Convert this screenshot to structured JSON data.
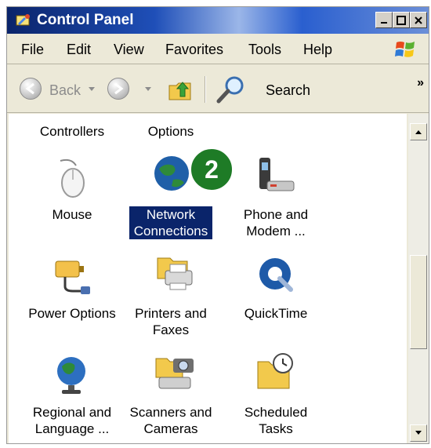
{
  "window": {
    "title": "Control Panel"
  },
  "menu": [
    "File",
    "Edit",
    "View",
    "Favorites",
    "Tools",
    "Help"
  ],
  "toolbar": {
    "back_label": "Back",
    "search_label": "Search",
    "chevron": "»"
  },
  "items": {
    "controllers": "Controllers",
    "options": "Options",
    "mouse": "Mouse",
    "network_1": "Network",
    "network_2": "Connections",
    "phone_1": "Phone and",
    "phone_2": "Modem ...",
    "power": "Power Options",
    "printers_1": "Printers and",
    "printers_2": "Faxes",
    "quicktime": "QuickTime",
    "regional_1": "Regional and",
    "regional_2": "Language ...",
    "scanners_1": "Scanners and",
    "scanners_2": "Cameras",
    "scheduled_1": "Scheduled",
    "scheduled_2": "Tasks"
  },
  "badge": {
    "number": "2"
  },
  "colors": {
    "selection": "#0a246a",
    "badge": "#1e7b26",
    "title_bar": "#0a246a"
  }
}
